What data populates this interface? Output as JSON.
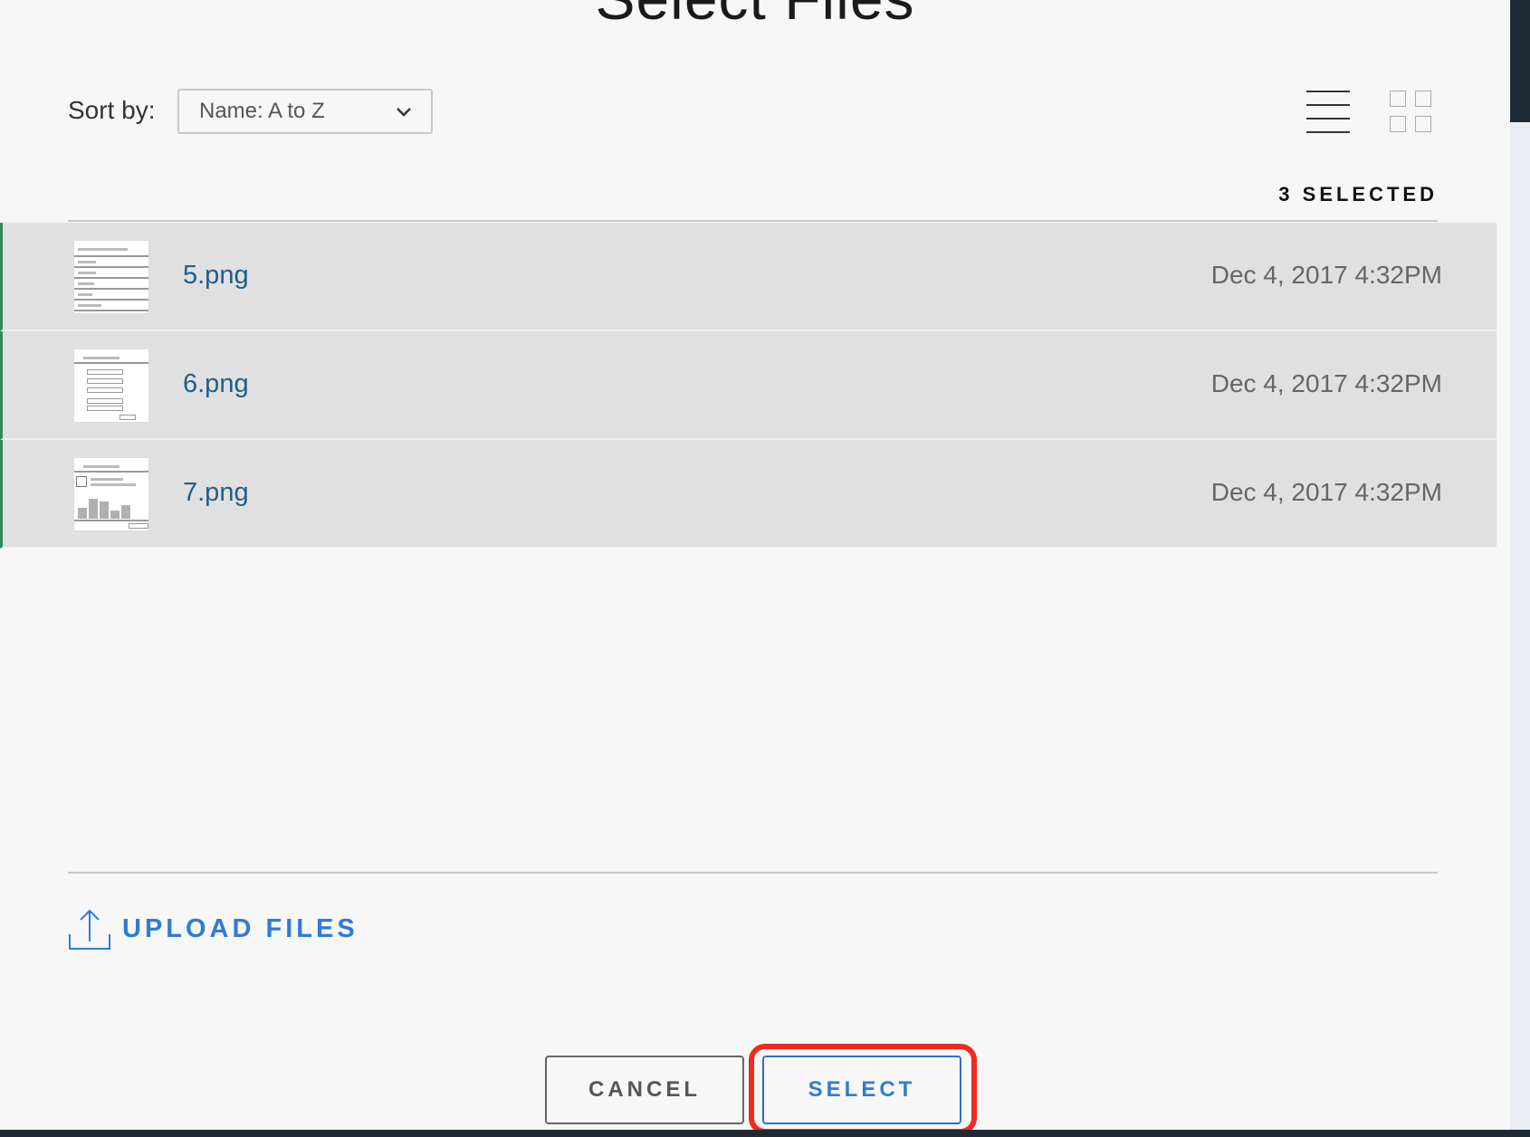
{
  "dialog": {
    "title": "Select Files"
  },
  "toolbar": {
    "sort_label": "Sort by:",
    "sort_value": "Name: A to Z",
    "list_view_icon": "list-view-icon",
    "grid_view_icon": "grid-view-icon"
  },
  "selection": {
    "count_label": "3 SELECTED"
  },
  "files": [
    {
      "name": "5.png",
      "date": "Dec 4, 2017 4:32PM"
    },
    {
      "name": "6.png",
      "date": "Dec 4, 2017 4:32PM"
    },
    {
      "name": "7.png",
      "date": "Dec 4, 2017 4:32PM"
    }
  ],
  "upload": {
    "label": "UPLOAD FILES",
    "icon": "upload-icon"
  },
  "actions": {
    "cancel_label": "CANCEL",
    "select_label": "SELECT"
  },
  "colors": {
    "accent": "#2f7bd6",
    "file_link": "#1d5f86",
    "highlight": "#ef2a1e",
    "selected_marker": "#2e8b57"
  }
}
